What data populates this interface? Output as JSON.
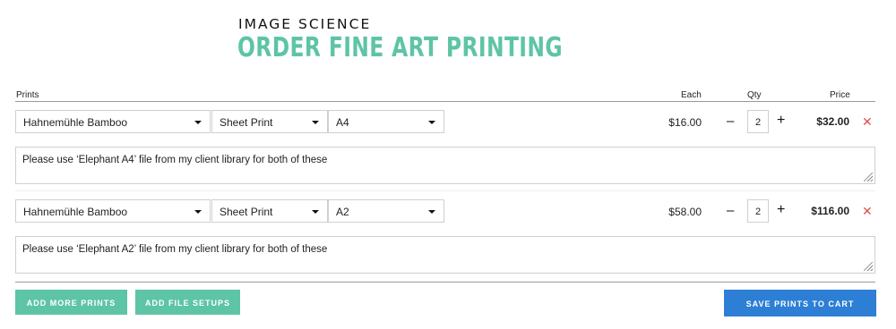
{
  "header": {
    "brand": "IMAGE SCIENCE",
    "title": "ORDER FINE ART PRINTING"
  },
  "columns": {
    "prints": "Prints",
    "each": "Each",
    "qty": "Qty",
    "price": "Price"
  },
  "rows": [
    {
      "paper": "Hahnemühle Bamboo",
      "print_type": "Sheet Print",
      "size": "A4",
      "each": "$16.00",
      "qty": "2",
      "price": "$32.00",
      "note": "Please use ‘Elephant A4’ file from my client library for both of these"
    },
    {
      "paper": "Hahnemühle Bamboo",
      "print_type": "Sheet Print",
      "size": "A2",
      "each": "$58.00",
      "qty": "2",
      "price": "$116.00",
      "note": "Please use ‘Elephant A2’ file from my client library for both of these"
    }
  ],
  "controls": {
    "minus": "–",
    "plus": "+",
    "remove": "✕"
  },
  "buttons": {
    "add_more": "ADD MORE PRINTS",
    "add_setups": "ADD FILE SETUPS",
    "save": "SAVE PRINTS TO CART"
  },
  "colors": {
    "accent": "#5ec4a6",
    "primary": "#2d7fd6",
    "remove": "#e0504a"
  }
}
